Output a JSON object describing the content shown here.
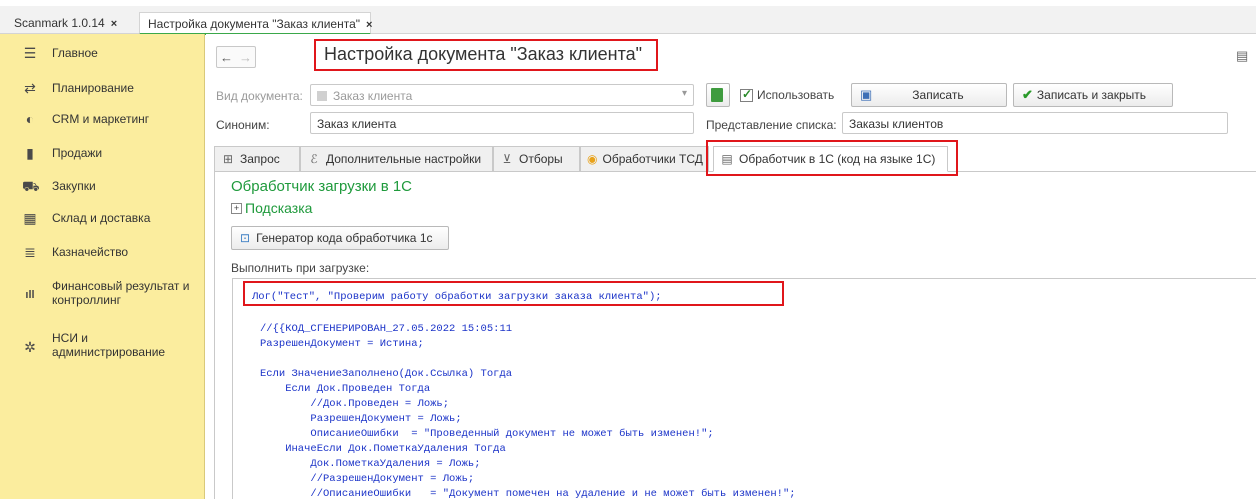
{
  "tabs": [
    {
      "label": "Scanmark 1.0.14"
    },
    {
      "label": "Настройка документа \"Заказ клиента\""
    }
  ],
  "sidebar": {
    "items": [
      {
        "label": "Главное",
        "icon": "menu-icon"
      },
      {
        "label": "Планирование",
        "icon": "planning-icon"
      },
      {
        "label": "CRM и маркетинг",
        "icon": "crm-icon"
      },
      {
        "label": "Продажи",
        "icon": "sales-icon"
      },
      {
        "label": "Закупки",
        "icon": "cart-icon"
      },
      {
        "label": "Склад и доставка",
        "icon": "warehouse-icon"
      },
      {
        "label": "Казначейство",
        "icon": "treasury-icon"
      },
      {
        "label": "Финансовый результат и",
        "label2": "контроллинг",
        "icon": "finance-icon"
      },
      {
        "label": "НСИ и",
        "label2": "администрирование",
        "icon": "gear-icon"
      }
    ]
  },
  "header": {
    "title": "Настройка документа \"Заказ клиента\""
  },
  "form": {
    "doc_type_label": "Вид документа:",
    "doc_type_value": "Заказ клиента",
    "use_label": "Использовать",
    "save_label": "Записать",
    "save_close_label": "Записать и закрыть",
    "synonym_label": "Синоним:",
    "synonym_value": "Заказ клиента",
    "list_repr_label": "Представление списка:",
    "list_repr_value": "Заказы клиентов"
  },
  "inner_tabs": [
    {
      "label": "Запрос",
      "icon": "query-icon"
    },
    {
      "label": "Дополнительные настройки",
      "icon": "settings-icon"
    },
    {
      "label": "Отборы",
      "icon": "filter-icon"
    },
    {
      "label": "Обработчики ТСД",
      "icon": "handler-icon"
    },
    {
      "label": "Обработчик в 1С (код на языке 1С)",
      "icon": "code-icon"
    }
  ],
  "panel": {
    "heading": "Обработчик загрузки в 1С",
    "hint": "Подсказка",
    "generator_label": "Генератор кода обработчика 1с",
    "execute_label": "Выполнить при загрузке:"
  },
  "code_lines": [
    "Лог(\"Тест\", \"Проверим работу обработки загрузки заказа клиента\");",
    "//{{КОД_СГЕНЕРИРОВАН_27.05.2022 15:05:11",
    "РазрешенДокумент = Истина;",
    "",
    "Если ЗначениеЗаполнено(Док.Ссылка) Тогда",
    "    Если Док.Проведен Тогда",
    "        //Док.Проведен = Ложь;",
    "        РазрешенДокумент = Ложь;",
    "        ОписаниеОшибки  = \"Проведенный документ не может быть изменен!\";",
    "    ИначеЕсли Док.ПометкаУдаления Тогда",
    "        Док.ПометкаУдаления = Ложь;",
    "        //РазрешенДокумент = Ложь;",
    "        //ОписаниеОшибки   = \"Документ помечен на удаление и не может быть изменен!\";"
  ],
  "colors": {
    "sidebar_bg": "#fbed9e",
    "highlight_red": "#e0161b",
    "accent_green": "#1f9a3c",
    "code_blue": "#1b33c8"
  }
}
